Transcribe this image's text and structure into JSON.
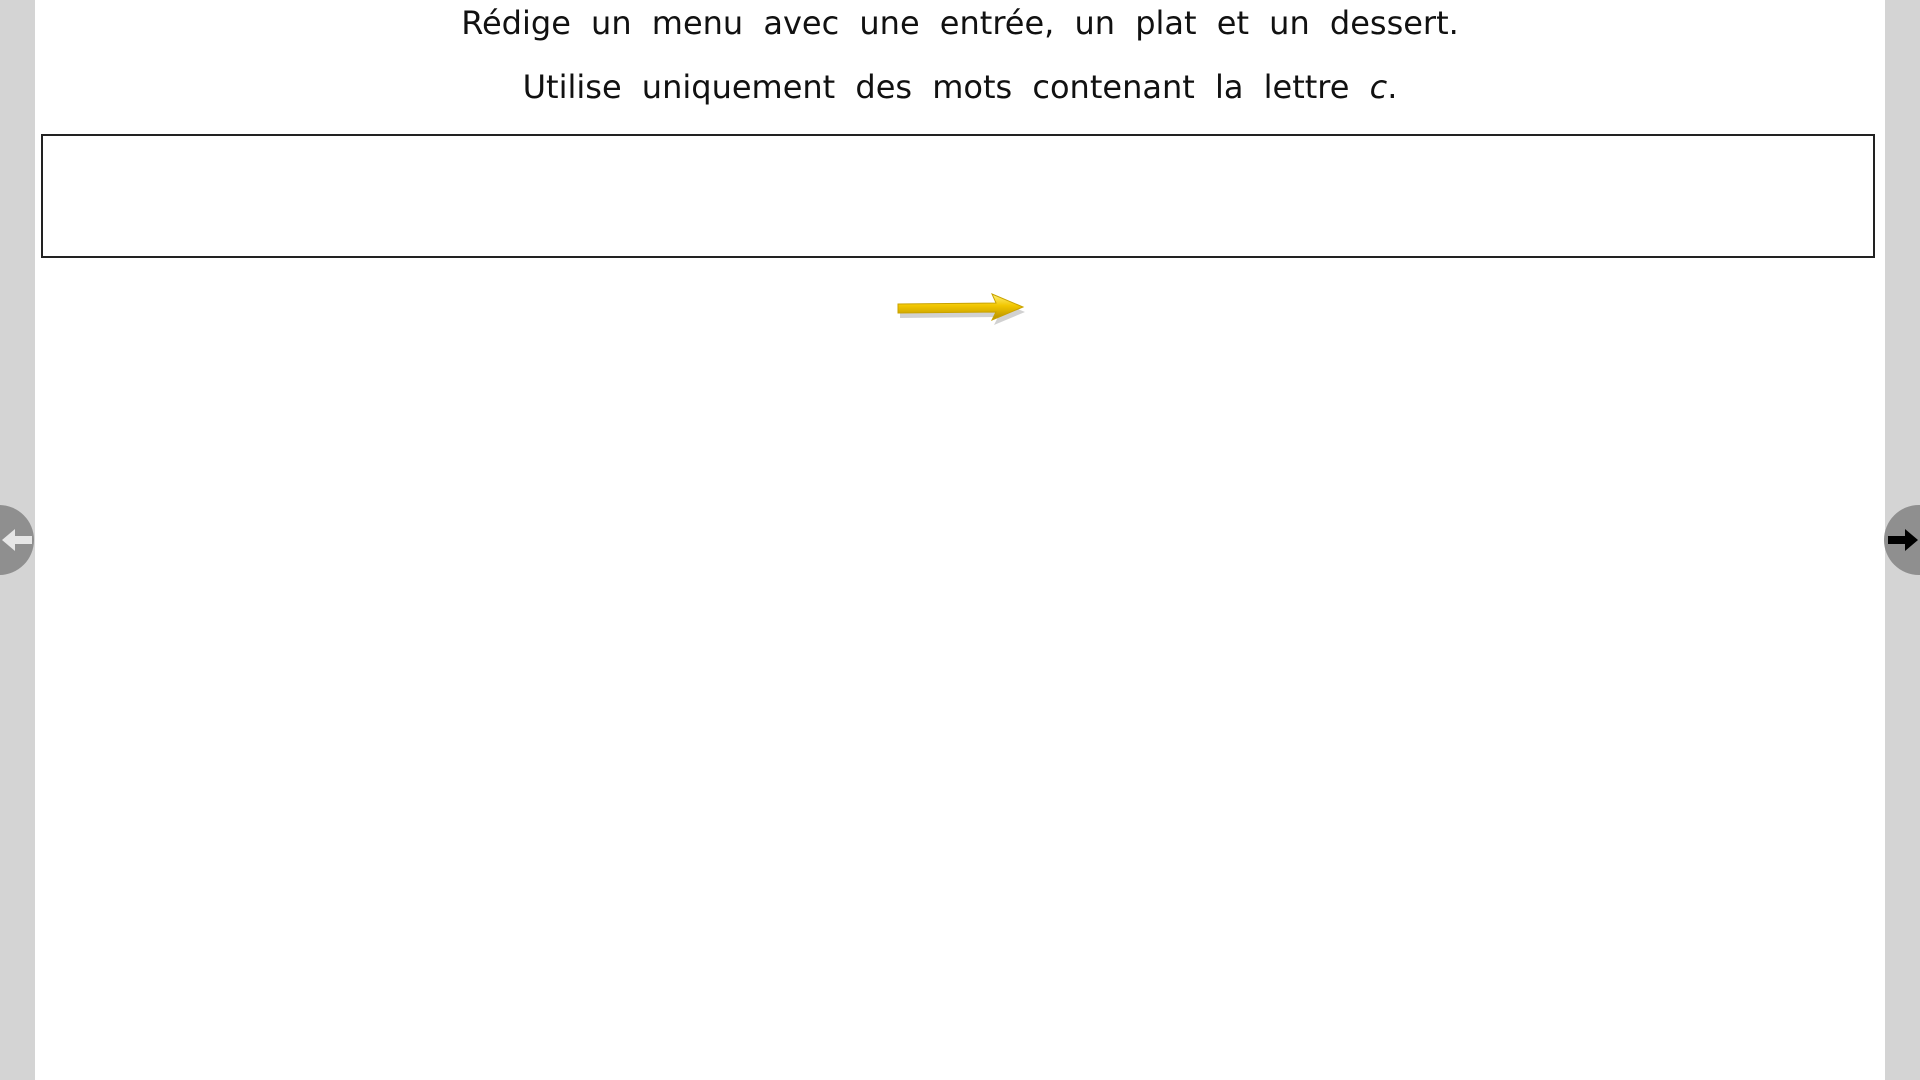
{
  "instructions": {
    "line1": "Rédige un menu avec une entrée, un plat et un dessert.",
    "line2_prefix": "Utilise uniquement des mots contenant la lettre ",
    "line2_letter": "c",
    "line2_suffix": "."
  },
  "answer": {
    "value": "",
    "placeholder": ""
  },
  "colors": {
    "side_background": "#d4d4d4",
    "page_background": "#ffffff",
    "arrow_yellow": "#f2c600",
    "nav_button": "#8f8f8f",
    "next_arrow": "#000000",
    "prev_arrow": "#e6e6e6"
  },
  "icons": {
    "continue": "yellow-arrow-right-icon",
    "previous": "arrow-left-icon",
    "next": "arrow-right-icon"
  }
}
